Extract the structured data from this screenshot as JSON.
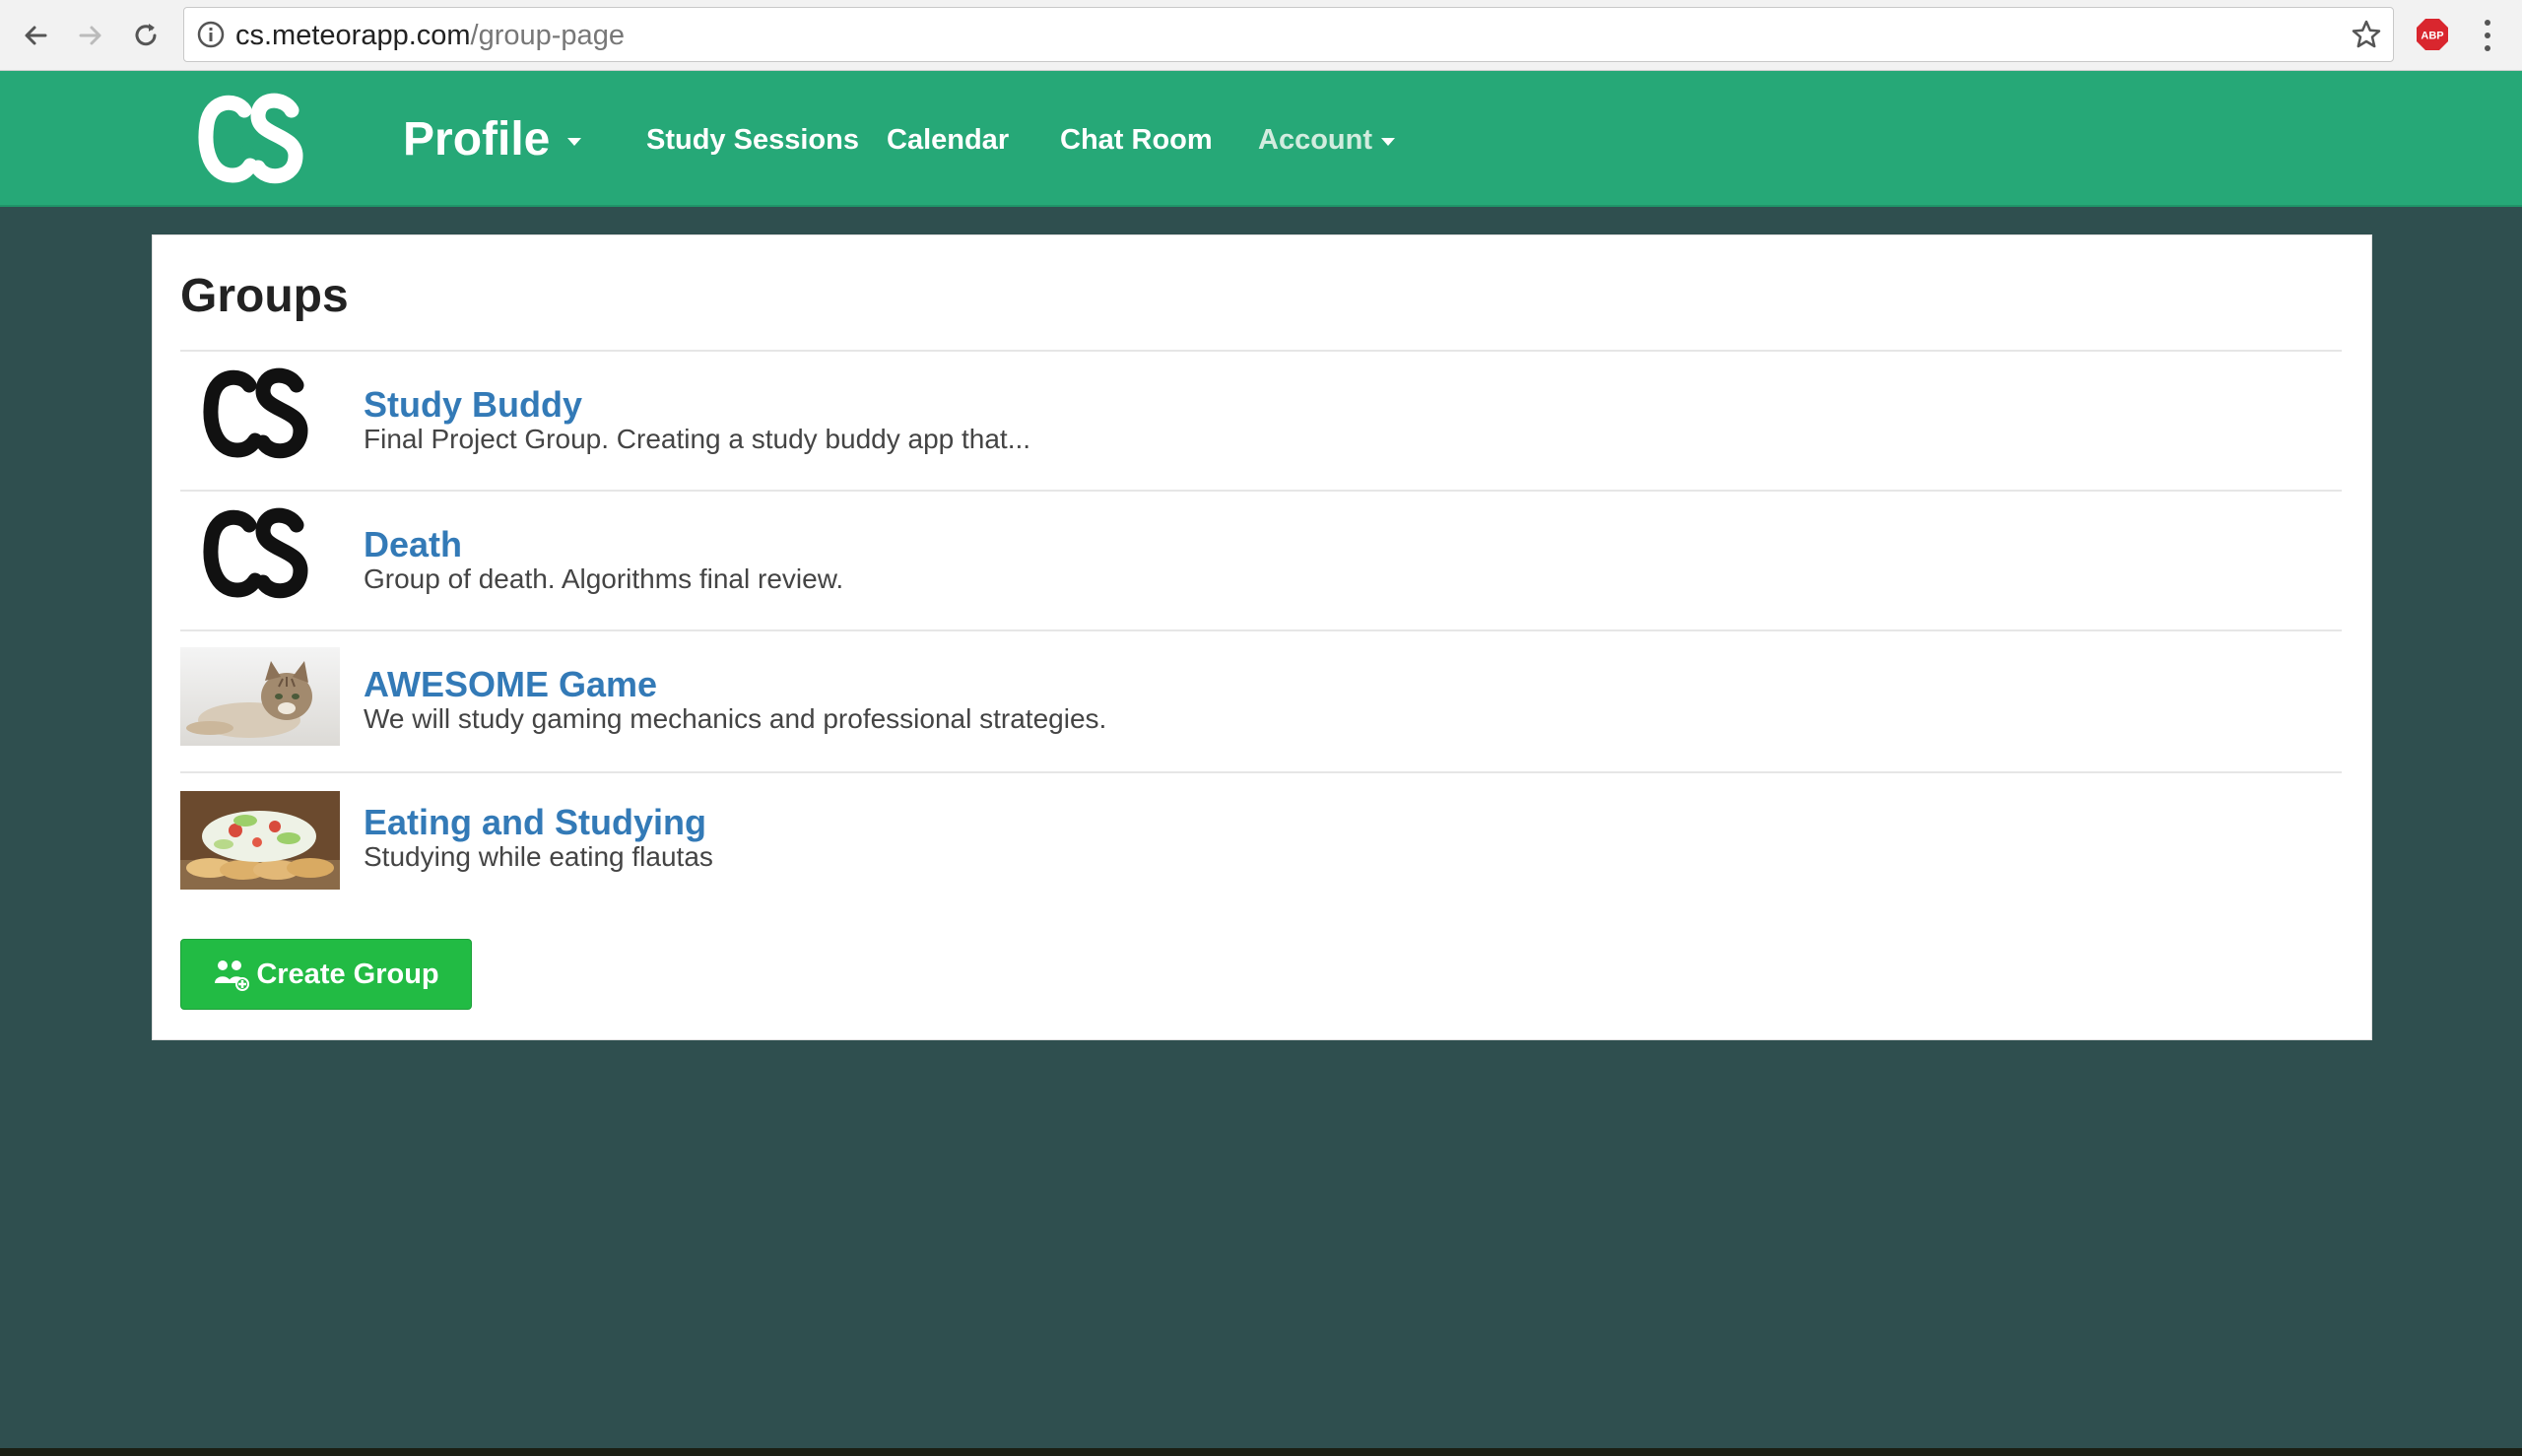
{
  "browser": {
    "url_host": "cs.meteorapp.com",
    "url_path": "/group-page",
    "extension_label": "ABP"
  },
  "navbar": {
    "profile_label": "Profile",
    "links": [
      "Study Sessions",
      "Calendar",
      "Chat Room"
    ],
    "account_label": "Account",
    "accent_color": "#26a877"
  },
  "panel": {
    "title": "Groups",
    "groups": [
      {
        "name": "Study Buddy",
        "description": "Final Project Group. Creating a study buddy app that...",
        "image": "cs-logo"
      },
      {
        "name": "Death",
        "description": "Group of death. Algorithms final review.",
        "image": "cs-logo"
      },
      {
        "name": "AWESOME Game",
        "description": "We will study gaming mechanics and professional strategies.",
        "image": "cat-photo"
      },
      {
        "name": "Eating and Studying",
        "description": "Studying while eating flautas",
        "image": "flautas-photo"
      }
    ],
    "create_button_label": "Create Group",
    "link_color": "#337ab7",
    "button_color": "#22bb44"
  }
}
